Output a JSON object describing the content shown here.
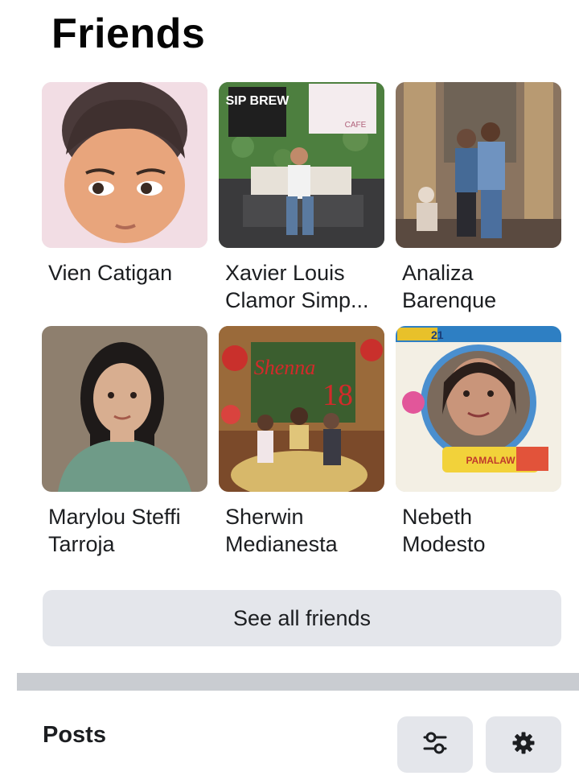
{
  "friends": {
    "title": "Friends",
    "items": [
      {
        "name": "Vien Catigan"
      },
      {
        "name": "Xavier Louis\nClamor Simp..."
      },
      {
        "name": "Analiza\nBarenque"
      },
      {
        "name": "Marylou Steffi\nTarroja"
      },
      {
        "name": "Sherwin\nMedianesta"
      },
      {
        "name": "Nebeth\nModesto"
      }
    ],
    "photo_texts": {
      "sip_brew": "SIP BREW",
      "cafe": "CAFE",
      "shenna": "Shenna",
      "eighteen": "18",
      "badge": "21",
      "frame_text": "PAMALAW"
    },
    "see_all_label": "See all friends"
  },
  "posts": {
    "title": "Posts",
    "filter_icon": "sliders-icon",
    "settings_icon": "gear-icon"
  },
  "colors": {
    "button_bg": "#e4e6eb",
    "divider": "#c9ccd1",
    "text": "#1c1e21"
  }
}
